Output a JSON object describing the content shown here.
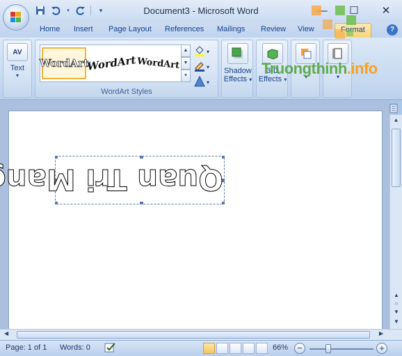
{
  "window": {
    "title": "Document3 - Microsoft Word",
    "minimize_icon": "minimize-icon",
    "maximize_icon": "maximize-icon",
    "close_icon": "close-icon"
  },
  "quick_access": {
    "save_icon": "save-icon",
    "undo_icon": "undo-icon",
    "redo_icon": "redo-icon",
    "customize_icon": "customize-qat-icon"
  },
  "tabs": [
    {
      "label": "Home"
    },
    {
      "label": "Insert"
    },
    {
      "label": "Page Layout"
    },
    {
      "label": "References"
    },
    {
      "label": "Mailings"
    },
    {
      "label": "Review"
    },
    {
      "label": "View"
    },
    {
      "label": "Format",
      "active": true
    }
  ],
  "ribbon": {
    "text_group": {
      "button_label": "Text",
      "icon_label": "AV"
    },
    "wordart_styles": {
      "group_label": "WordArt Styles",
      "samples": [
        "WordArt",
        "WordArt",
        "WordArt"
      ]
    },
    "shadow_effects": {
      "label_line1": "Shadow",
      "label_line2": "Effects"
    },
    "threed_effects": {
      "label_line1": "3-D",
      "label_line2": "Effects"
    }
  },
  "document": {
    "wordart_text": "Quan Tri Mang"
  },
  "status_bar": {
    "page": "Page: 1 of 1",
    "words": "Words: 0",
    "zoom": "66%",
    "zoom_minus": "−",
    "zoom_plus": "+"
  },
  "watermark": {
    "text_main": "Truongthinh",
    "text_suffix": ".info"
  },
  "colors": {
    "accent": "#f5d67a",
    "ribbon": "#c6d9f0",
    "watermark_green": "#4aa034",
    "watermark_orange": "#ff9600"
  }
}
